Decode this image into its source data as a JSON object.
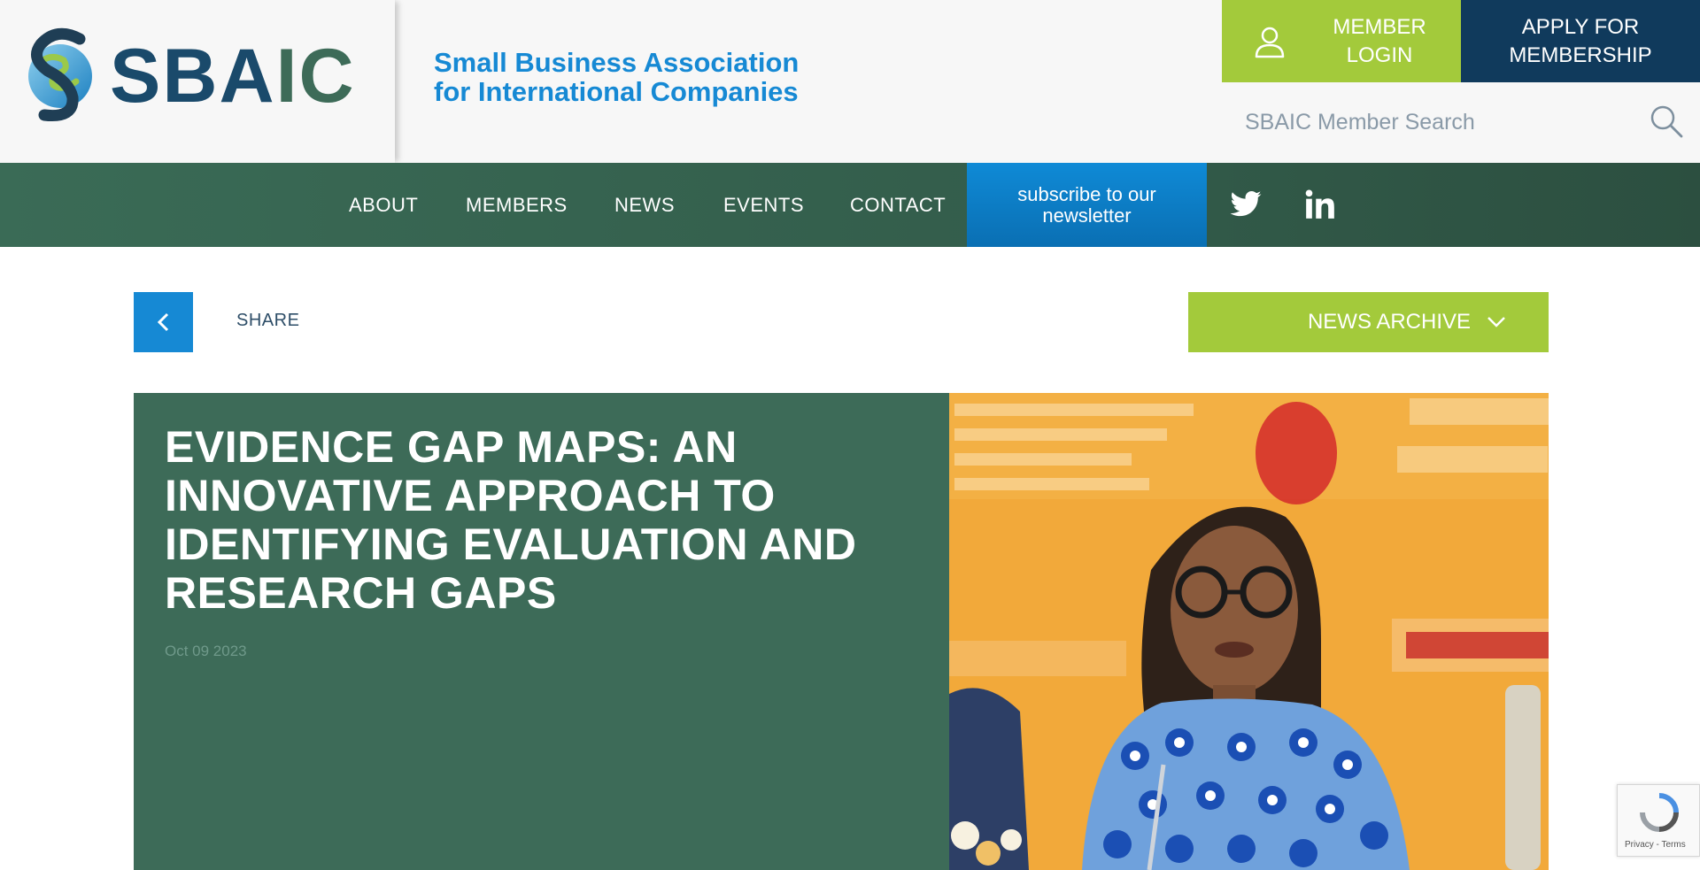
{
  "header": {
    "logo_text_a": "SBA",
    "logo_text_b": "IC",
    "tagline_line1": "Small Business Association",
    "tagline_line2": "for International Companies",
    "login_line1": "MEMBER",
    "login_line2": "LOGIN",
    "apply_line1": "APPLY FOR",
    "apply_line2": "MEMBERSHIP",
    "search_placeholder": "SBAIC Member Search"
  },
  "nav": {
    "items": [
      "ABOUT",
      "MEMBERS",
      "NEWS",
      "EVENTS",
      "CONTACT"
    ],
    "subscribe_line1": "subscribe to our",
    "subscribe_line2": "newsletter",
    "social": [
      "twitter-icon",
      "linkedin-icon"
    ]
  },
  "toolbar": {
    "share_label": "SHARE",
    "archive_label": "NEWS ARCHIVE"
  },
  "article": {
    "title": "EVIDENCE GAP MAPS: AN INNOVATIVE APPROACH TO IDENTIFYING EVALUATION AND RESEARCH GAPS",
    "date": "Oct 09 2023"
  },
  "recaptcha": {
    "text": "Privacy - Terms"
  },
  "colors": {
    "brand_green": "#3d6b58",
    "lime": "#a3ca3b",
    "navy": "#103a5c",
    "blue": "#1689d4"
  }
}
